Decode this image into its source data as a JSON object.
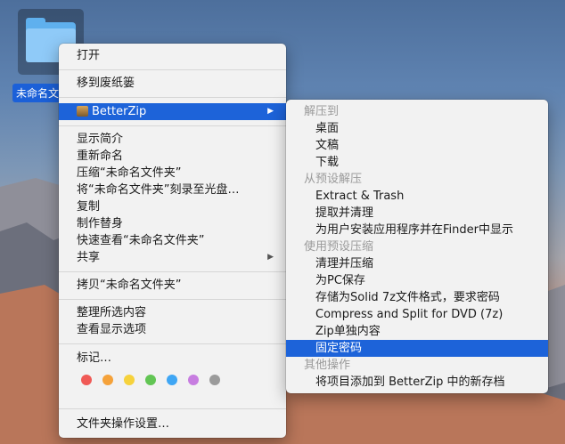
{
  "desktop": {
    "folder_label": "未命名文"
  },
  "main_menu": {
    "open": "打开",
    "move_to_trash": "移到废纸篓",
    "betterzip": "BetterZip",
    "get_info": "显示简介",
    "rename": "重新命名",
    "compress": "压缩“未命名文件夹”",
    "burn": "将“未命名文件夹”刻录至光盘…",
    "duplicate": "复制",
    "make_alias": "制作替身",
    "quick_look": "快速查看“未命名文件夹”",
    "share": "共享",
    "copy": "拷贝“未命名文件夹”",
    "clean_up": "整理所选内容",
    "view_options": "查看显示选项",
    "tags": "标记…",
    "folder_actions": "文件夹操作设置…"
  },
  "tag_colors": [
    "#f05a56",
    "#f5a23a",
    "#f6d23c",
    "#62c554",
    "#3fa6f4",
    "#c77de0",
    "#9b9b9b"
  ],
  "sub_menu": {
    "h_extract_to": "解压到",
    "desktop": "桌面",
    "documents": "文稿",
    "downloads": "下载",
    "h_extract_preset": "从预设解压",
    "extract_trash": "Extract & Trash",
    "extract_clean": "提取并清理",
    "extract_finder": "为用户安装应用程序并在Finder中显示",
    "h_compress_preset": "使用预设压缩",
    "clean_compress": "清理并压缩",
    "save_for_pc": "为PC保存",
    "solid_7z": "存储为Solid 7z文件格式，要求密码",
    "compress_dvd": "Compress and Split for DVD (7z)",
    "zip_single": "Zip单独内容",
    "fixed_password": "固定密码",
    "h_other": "其他操作",
    "add_to_archive": "将项目添加到 BetterZip 中的新存档"
  }
}
